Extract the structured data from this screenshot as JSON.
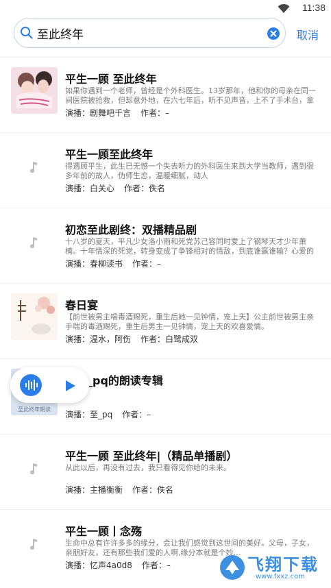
{
  "status": {
    "time": "11:38"
  },
  "search": {
    "value": "至此终年",
    "cancel_label": "取消"
  },
  "colors": {
    "accent": "#2b7de9",
    "text": "#111111",
    "muted": "#7a7a7a"
  },
  "results": [
    {
      "title": "平生一顾 至此终年",
      "desc": "如果你遇到一个老师，曾经是个外科医生。13岁那年，他和你的母亲在同一间医院被抢救，但却意外地，在六七年后，听不见声音，上不了手术台，拿起…",
      "host_label": "演播：",
      "host": "剧舞吧千言",
      "author_label": "作者：",
      "author": "–",
      "cover": "image"
    },
    {
      "title": "平生一顾至此终年",
      "desc": "得遇顾平生，此生已无憾一个失去听力的外科医生来到大学当教师，遇到很多年前的故人，伪师生恋，温暖细腻，动人",
      "host_label": "演播：",
      "host": "白关心",
      "author_label": "作者：",
      "author": "佚名",
      "cover": "note"
    },
    {
      "title": "初恋至此剧终：双播精品剧",
      "desc": "十八岁的夏天，平凡少女洛小雨和死党苏己容同时爱上了钢琴天才少年萧楠。十年情深的死党，转身变成了争锋相对的情敌，到底谁赢谁输？心爱的少年…",
      "host_label": "演播：",
      "host": "春柳读书",
      "author_label": "作者：",
      "author": "–",
      "cover": "note"
    },
    {
      "title": "春日宴",
      "desc": "【前世被男主喘毒酒赐死，重生后她一见钟情，宠上天】公主前世被男主亲手喘的毒酒赐死，重生后男主一见钟情，宠上天的欢喜爱情。",
      "host_label": "演播：",
      "host": "温水，阿伤",
      "author_label": "作者：",
      "author": "白鹭成双",
      "cover": "image"
    },
    {
      "title": "终年_pq的朗读专辑",
      "desc": "_pq",
      "host_label": "演播：",
      "host": "至_pq",
      "author_label": "作者：",
      "author": "–",
      "cover": "image"
    },
    {
      "title": "平生一顾 至此终年|（精品单播剧）",
      "desc": "从此以后，再没有过去，我只看得见你给的未来。",
      "host_label": "演播：",
      "host": "主播衡衡",
      "author_label": "作者：",
      "author": "佚名",
      "cover": "note"
    },
    {
      "title": "平生一顾丨念殇",
      "desc": "生命中总有许许多多的缘分，会让我们感觉到这世间的美好。父母，子女，亲朋好友，还有那些我们爱的人啊,缘分本就是个妙…",
      "host_label": "演播：",
      "host": "忆声4a0d8",
      "author_label": "作者：",
      "author": "–",
      "cover": "note"
    }
  ],
  "cover5_caption": "至此终年朗读",
  "watermark": {
    "text": "飞翔下载",
    "url": "www.fxxz.com"
  }
}
